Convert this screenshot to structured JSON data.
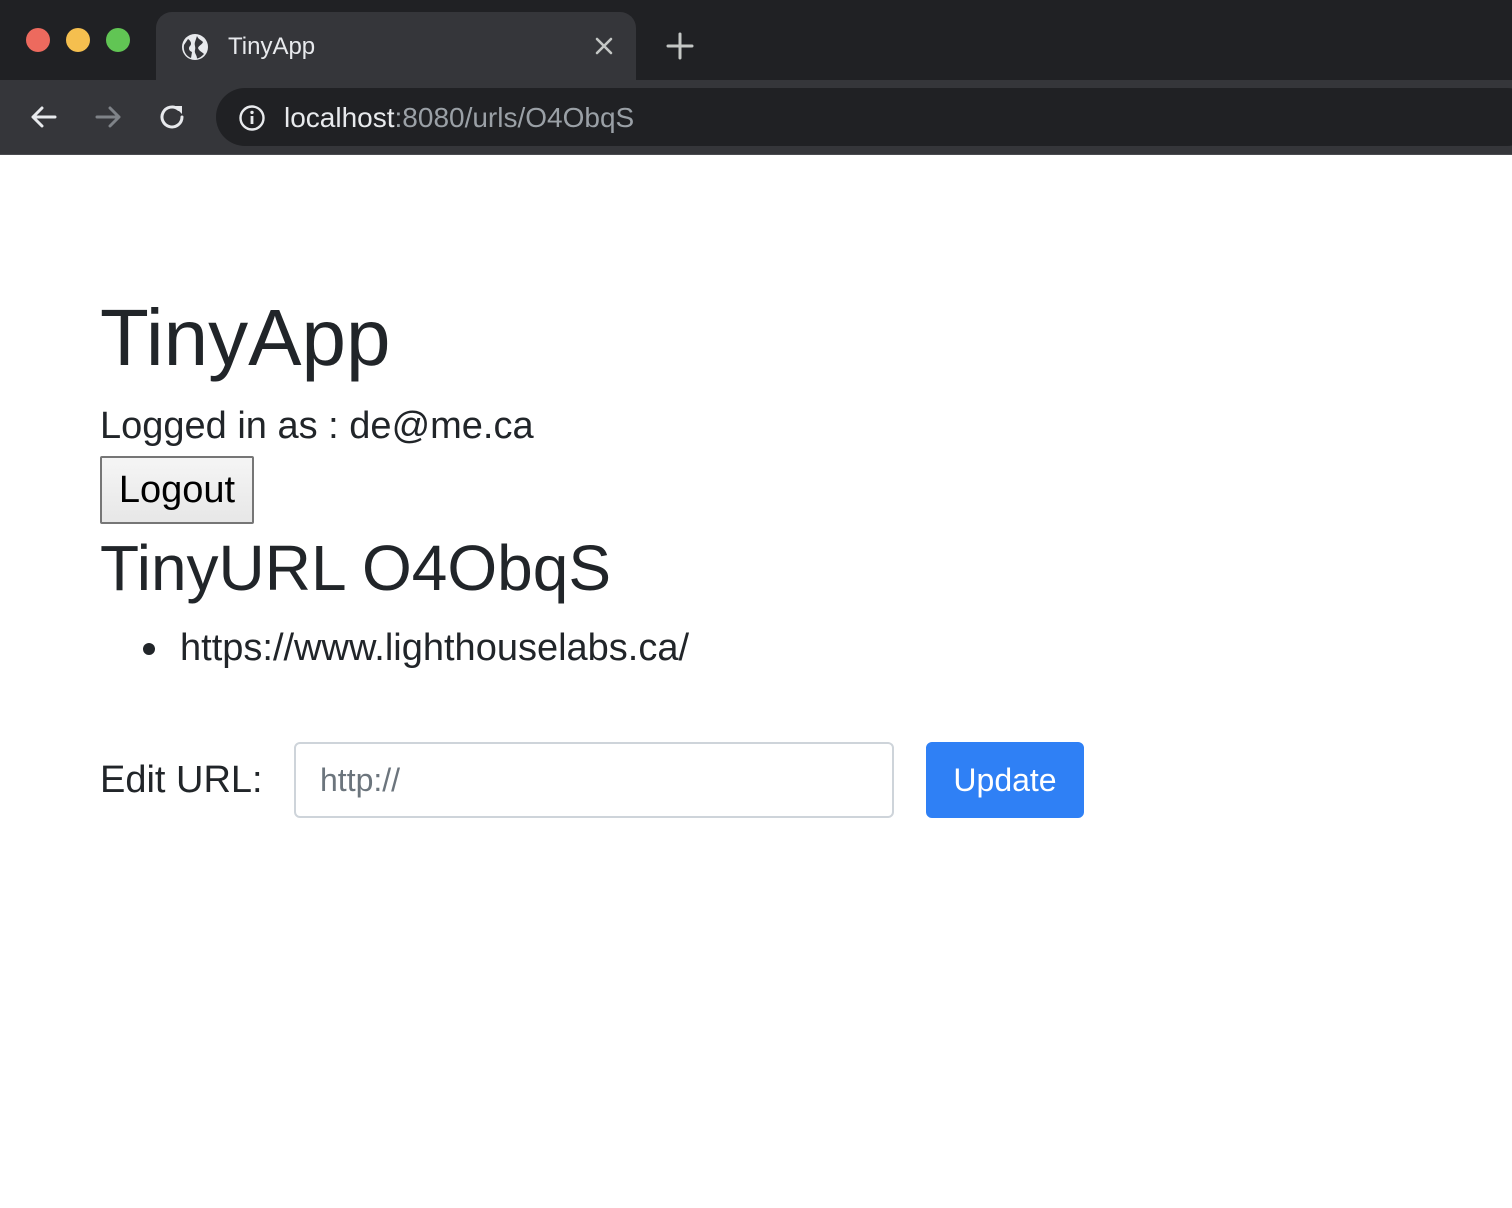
{
  "browser": {
    "tab_title": "TinyApp",
    "url_host": "localhost",
    "url_rest": ":8080/urls/O4ObqS"
  },
  "page": {
    "app_title": "TinyApp",
    "logged_in_text": "Logged in as : de@me.ca",
    "logout_label": "Logout",
    "tinyurl_heading": "TinyURL O4ObqS",
    "long_urls": [
      "https://www.lighthouselabs.ca/"
    ],
    "edit_label": "Edit URL:",
    "edit_placeholder": "http://",
    "update_label": "Update"
  },
  "colors": {
    "primary_button": "#2f80f5",
    "text": "#212529",
    "chrome_dark": "#202124",
    "chrome_tab": "#35363a"
  }
}
